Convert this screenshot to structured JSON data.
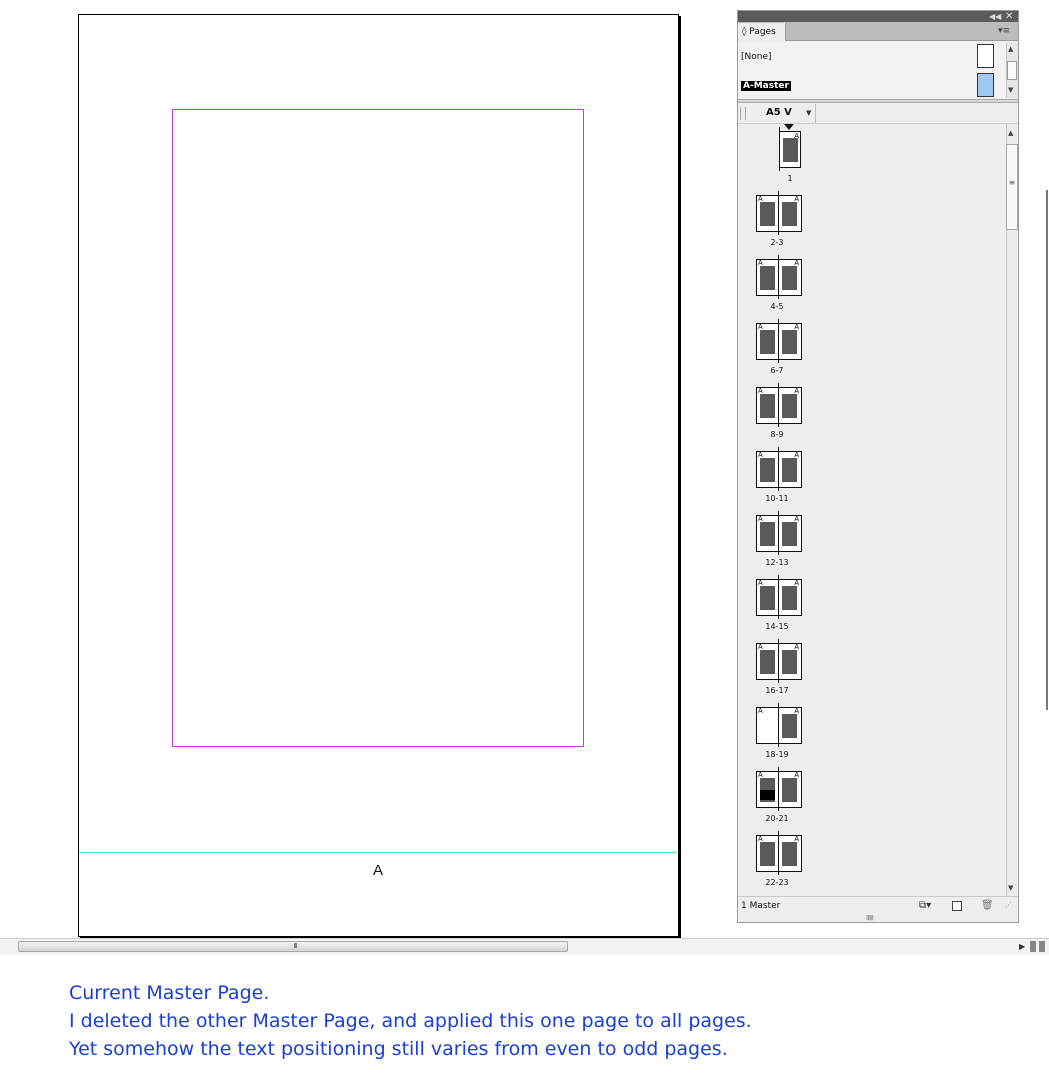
{
  "document": {
    "page_letter": "A"
  },
  "panel": {
    "tab_label": "◊ Pages",
    "masters": [
      {
        "label": "[None]",
        "selected": false
      },
      {
        "label": "A-Master",
        "selected": true
      }
    ],
    "page_size": "A5 V",
    "pages": [
      {
        "label": "1",
        "type": "single",
        "marks": [
          "A"
        ]
      },
      {
        "label": "2-3",
        "type": "spread",
        "marks": [
          "A",
          "A"
        ]
      },
      {
        "label": "4-5",
        "type": "spread",
        "marks": [
          "A",
          "A"
        ]
      },
      {
        "label": "6-7",
        "type": "spread",
        "marks": [
          "A",
          "A"
        ]
      },
      {
        "label": "8-9",
        "type": "spread",
        "marks": [
          "A",
          "A"
        ]
      },
      {
        "label": "10-11",
        "type": "spread",
        "marks": [
          "A",
          "A"
        ]
      },
      {
        "label": "12-13",
        "type": "spread",
        "marks": [
          "A",
          "A"
        ]
      },
      {
        "label": "14-15",
        "type": "spread",
        "marks": [
          "A",
          "A"
        ]
      },
      {
        "label": "16-17",
        "type": "spread",
        "marks": [
          "A",
          "A"
        ]
      },
      {
        "label": "18-19",
        "type": "spread",
        "marks": [
          "A",
          "A"
        ]
      },
      {
        "label": "20-21",
        "type": "spread",
        "marks": [
          "A",
          "A"
        ]
      },
      {
        "label": "22-23",
        "type": "spread",
        "marks": [
          "A",
          "A"
        ]
      }
    ],
    "footer_status": "1 Master",
    "icons": {
      "collapse": "double-chevron-left-icon",
      "close": "close-icon",
      "menu": "panel-menu-icon",
      "edit_size": "edit-page-size-icon",
      "new_page": "new-page-icon",
      "delete": "trash-icon"
    }
  },
  "colors": {
    "margin_guide": "#c43ad6",
    "column_guide": "#3fe0d8",
    "master_thumb": "#9fc9f4",
    "caption_text": "#1a3fd3"
  },
  "caption": {
    "line1": "Current Master Page.",
    "line2": "I deleted the other Master Page, and applied this one page to all pages.",
    "line3": "Yet somehow the text positioning still varies from even to odd pages."
  }
}
